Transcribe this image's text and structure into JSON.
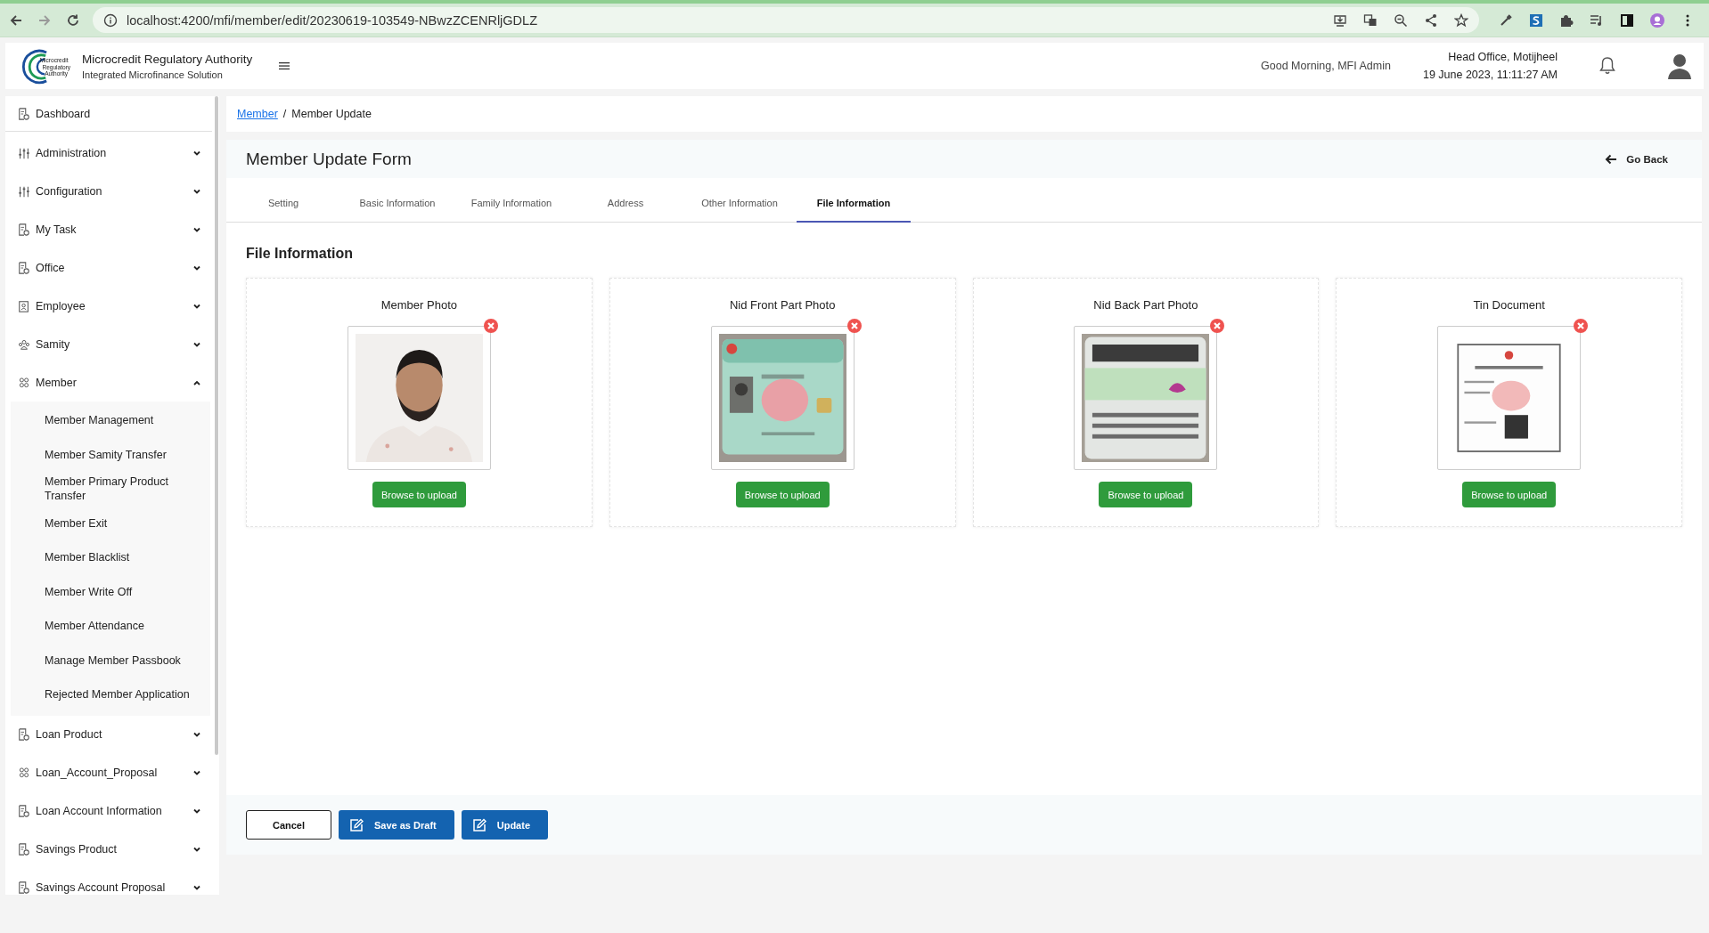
{
  "browser": {
    "url": "localhost:4200/mfi/member/edit/20230619-103549-NBwzZCENRljGDLZ"
  },
  "header": {
    "logo_lines": [
      "Microcredit",
      "Regulatory",
      "Authority"
    ],
    "title": "Microcredit Regulatory Authority",
    "subtitle": "Integrated Microfinance Solution",
    "greeting": "Good Morning, MFI Admin",
    "office": "Head Office, Motijheel",
    "datetime": "19 June 2023, 11:11:27 AM"
  },
  "sidebar": {
    "items": [
      {
        "label": "Dashboard",
        "kind": "document"
      },
      {
        "label": "Administration",
        "kind": "sliders",
        "expanded": false
      },
      {
        "label": "Configuration",
        "kind": "sliders",
        "expanded": false
      },
      {
        "label": "My Task",
        "kind": "document",
        "expanded": false
      },
      {
        "label": "Office",
        "kind": "document",
        "expanded": false
      },
      {
        "label": "Employee",
        "kind": "badge",
        "expanded": false
      },
      {
        "label": "Samity",
        "kind": "group",
        "expanded": false
      },
      {
        "label": "Member",
        "kind": "people",
        "expanded": true,
        "children": [
          {
            "label": "Member Management"
          },
          {
            "label": "Member Samity Transfer"
          },
          {
            "label": "Member Primary Product Transfer"
          },
          {
            "label": "Member Exit"
          },
          {
            "label": "Member Blacklist"
          },
          {
            "label": "Member Write Off"
          },
          {
            "label": "Member Attendance"
          },
          {
            "label": "Manage Member Passbook"
          },
          {
            "label": "Rejected Member Application"
          }
        ]
      },
      {
        "label": "Loan Product",
        "kind": "document",
        "expanded": false
      },
      {
        "label": "Loan_Account_Proposal",
        "kind": "people",
        "expanded": false
      },
      {
        "label": "Loan Account Information",
        "kind": "document",
        "expanded": false
      },
      {
        "label": "Savings Product",
        "kind": "document",
        "expanded": false
      },
      {
        "label": "Savings Account Proposal",
        "kind": "document",
        "expanded": false
      }
    ]
  },
  "breadcrumb_separator": "/",
  "breadcrumb": [
    {
      "label": "Member",
      "kind": "link"
    },
    {
      "label": "Member Update",
      "kind": "current"
    }
  ],
  "form": {
    "title": "Member Update Form",
    "back": "Go Back",
    "tabs": [
      {
        "label": "Setting",
        "selected": false
      },
      {
        "label": "Basic Information",
        "selected": false
      },
      {
        "label": "Family Information",
        "selected": false
      },
      {
        "label": "Address",
        "selected": false
      },
      {
        "label": "Other Information",
        "selected": false
      },
      {
        "label": "File Information",
        "selected": true
      }
    ],
    "section_title": "File Information",
    "files": [
      {
        "title": "Member Photo",
        "kind": "portrait",
        "button": "Browse to upload"
      },
      {
        "title": "Nid Front Part Photo",
        "kind": "card_front",
        "button": "Browse to upload"
      },
      {
        "title": "Nid Back Part Photo",
        "kind": "card_back",
        "button": "Browse to upload"
      },
      {
        "title": "Tin Document",
        "kind": "document",
        "button": "Browse to upload"
      }
    ],
    "actions": [
      {
        "label": "Cancel",
        "kind": "outline"
      },
      {
        "label": "Save as Draft",
        "kind": "primary"
      },
      {
        "label": "Update",
        "kind": "primary"
      }
    ]
  }
}
